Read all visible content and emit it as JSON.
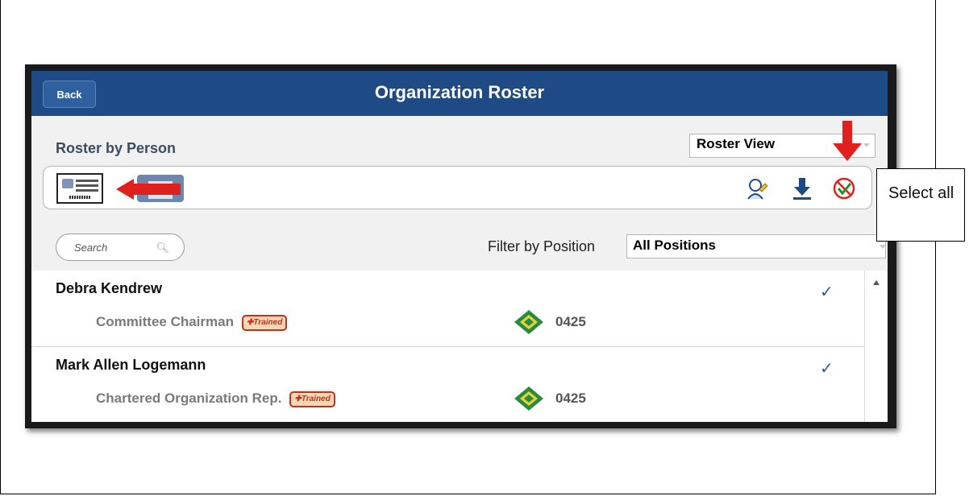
{
  "header": {
    "back_label": "Back",
    "title": "Organization Roster"
  },
  "roster": {
    "label": "Roster by Person",
    "view_select": "Roster View"
  },
  "toolbar": {
    "card_icon": "id-card-icon",
    "list_icon": "list-view-icon",
    "tool_icons": [
      "edit-person-icon",
      "download-icon",
      "select-all-icon"
    ]
  },
  "search": {
    "placeholder": "Search"
  },
  "filter": {
    "label": "Filter by Position",
    "value": "All Positions"
  },
  "members": [
    {
      "name": "Debra Kendrew",
      "position": "Committee Chairman",
      "badge": "Trained",
      "code": "0425"
    },
    {
      "name": "Mark Allen Logemann",
      "position": "Chartered Organization Rep.",
      "badge": "Trained",
      "code": "0425"
    }
  ],
  "callout": {
    "text": "Select all"
  },
  "colors": {
    "header": "#1e4a86",
    "accent_red": "#e0201c",
    "check": "#2e5aa0",
    "trained_badge": "#c42f1e"
  }
}
